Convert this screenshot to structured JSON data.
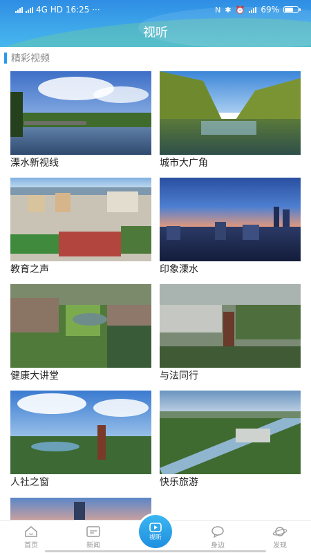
{
  "status_bar": {
    "left": "4G  HD  16:25 ···",
    "battery": "69%",
    "battery_level": 0.69
  },
  "header": {
    "title": "视听"
  },
  "section": {
    "title": "精彩视频"
  },
  "videos": [
    {
      "label": "溧水新视线"
    },
    {
      "label": "城市大广角"
    },
    {
      "label": "教育之声"
    },
    {
      "label": "印象溧水"
    },
    {
      "label": "健康大讲堂"
    },
    {
      "label": "与法同行"
    },
    {
      "label": "人社之窗"
    },
    {
      "label": "快乐旅游"
    }
  ],
  "bottom_nav": {
    "items": [
      {
        "label": "首页",
        "icon": "home-icon"
      },
      {
        "label": "新闻",
        "icon": "news-icon"
      },
      {
        "label": "视听",
        "icon": "play-icon"
      },
      {
        "label": "身边",
        "icon": "chat-icon"
      },
      {
        "label": "发现",
        "icon": "planet-icon"
      }
    ]
  },
  "colors": {
    "header": "#3ea8ea",
    "accent": "#2b9ae8",
    "label_text": "#222222",
    "nav_text": "#9a9a9a"
  }
}
